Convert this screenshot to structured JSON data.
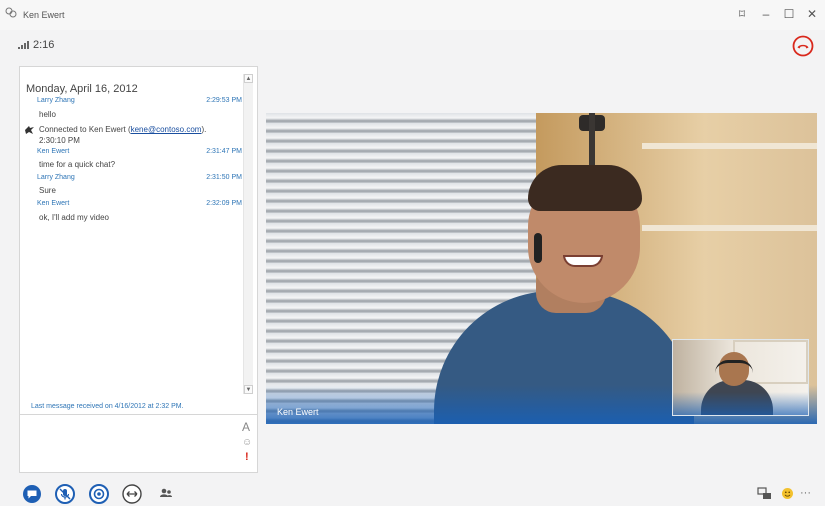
{
  "window": {
    "title": "Ken Ewert",
    "buttons": {
      "pin": "⌑",
      "minimize": "–",
      "maximize": "☐",
      "close": "✕"
    }
  },
  "call": {
    "duration": "2:16"
  },
  "conversation": {
    "date_header": "Monday, April 16, 2012",
    "messages": [
      {
        "sender": "Larry Zhang",
        "time": "2:29:53 PM",
        "text": "hello"
      },
      {
        "sender": "Ken Ewert",
        "time": "2:31:47 PM",
        "text": "time for a quick chat?"
      },
      {
        "sender": "Larry Zhang",
        "time": "2:31:50 PM",
        "text": "Sure"
      },
      {
        "sender": "Ken Ewert",
        "time": "2:32:09 PM",
        "text": "ok, I'll add my video"
      }
    ],
    "connected": {
      "prefix": "Connected to Ken Ewert (",
      "email": "kene@contoso.com",
      "suffix": ").",
      "time": "2:30:10 PM"
    },
    "last_message": "Last message received on 4/16/2012 at 2:32 PM.",
    "compose": {
      "font_label": "A",
      "emoticon": "☺",
      "importance": "!"
    }
  },
  "video": {
    "caller_name": "Ken Ewert"
  },
  "toolbar": {
    "items": [
      "im-icon",
      "microphone-icon",
      "video-icon",
      "screen-share-icon",
      "participants-icon"
    ],
    "right": {
      "more": "···"
    }
  },
  "colors": {
    "accent": "#1e5fb4",
    "hangup": "#d9281c",
    "link": "#2e75b6"
  }
}
